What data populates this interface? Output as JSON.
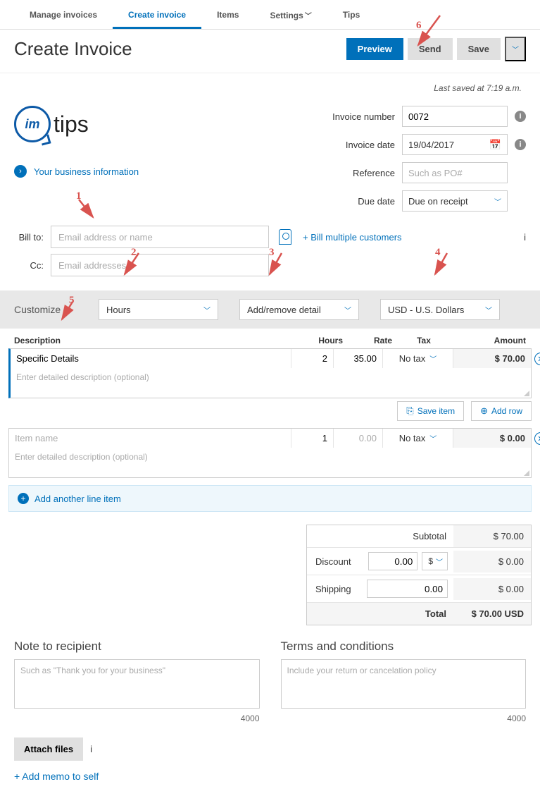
{
  "tabs": {
    "manage": "Manage invoices",
    "create": "Create invoice",
    "items": "Items",
    "settings": "Settings",
    "tips": "Tips"
  },
  "header": {
    "title": "Create Invoice",
    "preview": "Preview",
    "send": "Send",
    "save": "Save"
  },
  "last_saved": "Last saved at 7:19 a.m.",
  "logo_text": "tips",
  "logo_badge": "im",
  "biz_info_link": "Your business information",
  "inv_fields": {
    "number_label": "Invoice number",
    "number_value": "0072",
    "date_label": "Invoice date",
    "date_value": "19/04/2017",
    "ref_label": "Reference",
    "ref_placeholder": "Such as PO#",
    "due_label": "Due date",
    "due_value": "Due on receipt"
  },
  "billto": {
    "label": "Bill to:",
    "placeholder": "Email address or name",
    "cc_label": "Cc:",
    "cc_placeholder": "Email addresses",
    "multi_link": "+ Bill multiple customers"
  },
  "customize": {
    "title": "Customize",
    "qty_type": "Hours",
    "detail": "Add/remove detail",
    "currency": "USD - U.S. Dollars"
  },
  "table": {
    "col_desc": "Description",
    "col_hours": "Hours",
    "col_rate": "Rate",
    "col_tax": "Tax",
    "col_amount": "Amount"
  },
  "line1": {
    "name": "Specific Details",
    "hours": "2",
    "rate": "35.00",
    "tax": "No tax",
    "amount": "$ 70.00",
    "detail_placeholder": "Enter detailed description (optional)"
  },
  "line2": {
    "name_placeholder": "Item name",
    "hours": "1",
    "rate": "0.00",
    "tax": "No tax",
    "amount": "$ 0.00",
    "detail_placeholder": "Enter detailed description (optional)"
  },
  "row_actions": {
    "save_item": "Save item",
    "add_row": "Add row"
  },
  "add_line": "Add another line item",
  "totals": {
    "subtotal_label": "Subtotal",
    "subtotal_val": "$ 70.00",
    "discount_label": "Discount",
    "discount_val": "0.00",
    "discount_amt": "$ 0.00",
    "discount_unit": "$",
    "shipping_label": "Shipping",
    "shipping_val": "0.00",
    "shipping_amt": "$ 0.00",
    "total_label": "Total",
    "total_val": "$ 70.00 USD"
  },
  "notes": {
    "note_title": "Note to recipient",
    "note_placeholder": "Such as \"Thank you for your business\"",
    "terms_title": "Terms and conditions",
    "terms_placeholder": "Include your return or cancelation policy",
    "count": "4000"
  },
  "attach": "Attach files",
  "memo": "+  Add memo to self",
  "annotations": {
    "n1": "1",
    "n2": "2",
    "n3": "3",
    "n4": "4",
    "n5": "5",
    "n6": "6"
  }
}
